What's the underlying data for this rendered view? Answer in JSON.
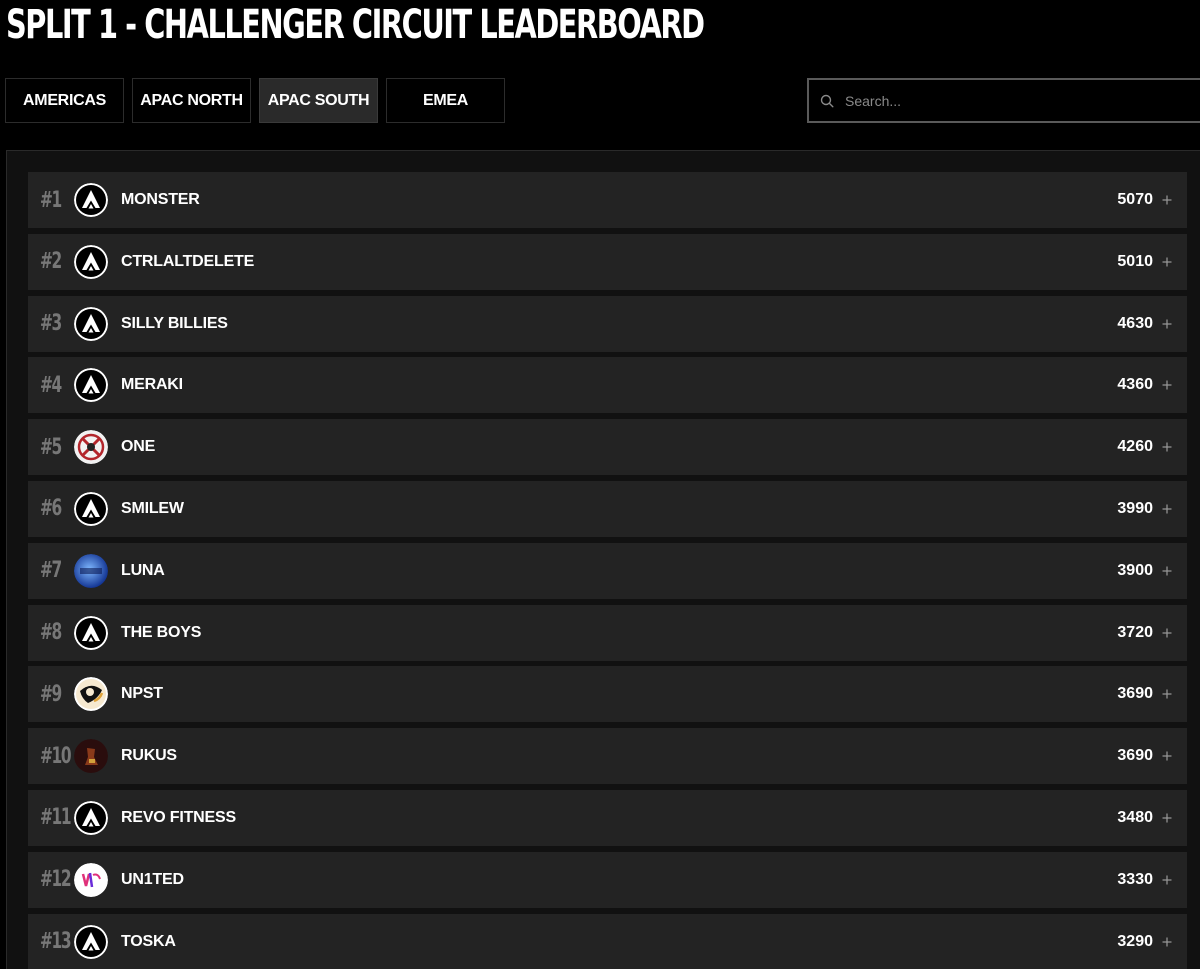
{
  "page": {
    "title": "SPLIT 1 - CHALLENGER CIRCUIT LEADERBOARD"
  },
  "tabs": [
    {
      "label": "AMERICAS",
      "active": false
    },
    {
      "label": "APAC NORTH",
      "active": false
    },
    {
      "label": "APAC SOUTH",
      "active": true
    },
    {
      "label": "EMEA",
      "active": false
    }
  ],
  "search": {
    "placeholder": "Search...",
    "value": "",
    "icon": "search-icon"
  },
  "leaderboard": {
    "rows": [
      {
        "rank": "#1",
        "team": "MONSTER",
        "points": "5070",
        "logo": "apex-logo-icon"
      },
      {
        "rank": "#2",
        "team": "CTRLALTDELETE",
        "points": "5010",
        "logo": "apex-logo-icon"
      },
      {
        "rank": "#3",
        "team": "SILLY BILLIES",
        "points": "4630",
        "logo": "apex-logo-icon"
      },
      {
        "rank": "#4",
        "team": "MERAKI",
        "points": "4360",
        "logo": "apex-logo-icon"
      },
      {
        "rank": "#5",
        "team": "ONE",
        "points": "4260",
        "logo": "one-team-logo-icon"
      },
      {
        "rank": "#6",
        "team": "SMILEW",
        "points": "3990",
        "logo": "apex-logo-icon"
      },
      {
        "rank": "#7",
        "team": "LUNA",
        "points": "3900",
        "logo": "luna-team-logo-icon"
      },
      {
        "rank": "#8",
        "team": "THE BOYS",
        "points": "3720",
        "logo": "apex-logo-icon"
      },
      {
        "rank": "#9",
        "team": "NPST",
        "points": "3690",
        "logo": "npst-team-logo-icon"
      },
      {
        "rank": "#10",
        "team": "RUKUS",
        "points": "3690",
        "logo": "rukus-team-logo-icon"
      },
      {
        "rank": "#11",
        "team": "REVO FITNESS",
        "points": "3480",
        "logo": "apex-logo-icon"
      },
      {
        "rank": "#12",
        "team": "UN1TED",
        "points": "3330",
        "logo": "un1ted-team-logo-icon"
      },
      {
        "rank": "#13",
        "team": "TOSKA",
        "points": "3290",
        "logo": "apex-logo-icon"
      }
    ]
  },
  "colors": {
    "background": "#000000",
    "row_background": "#232323",
    "rank_text": "#777777",
    "active_tab": "#2a2a2a"
  }
}
